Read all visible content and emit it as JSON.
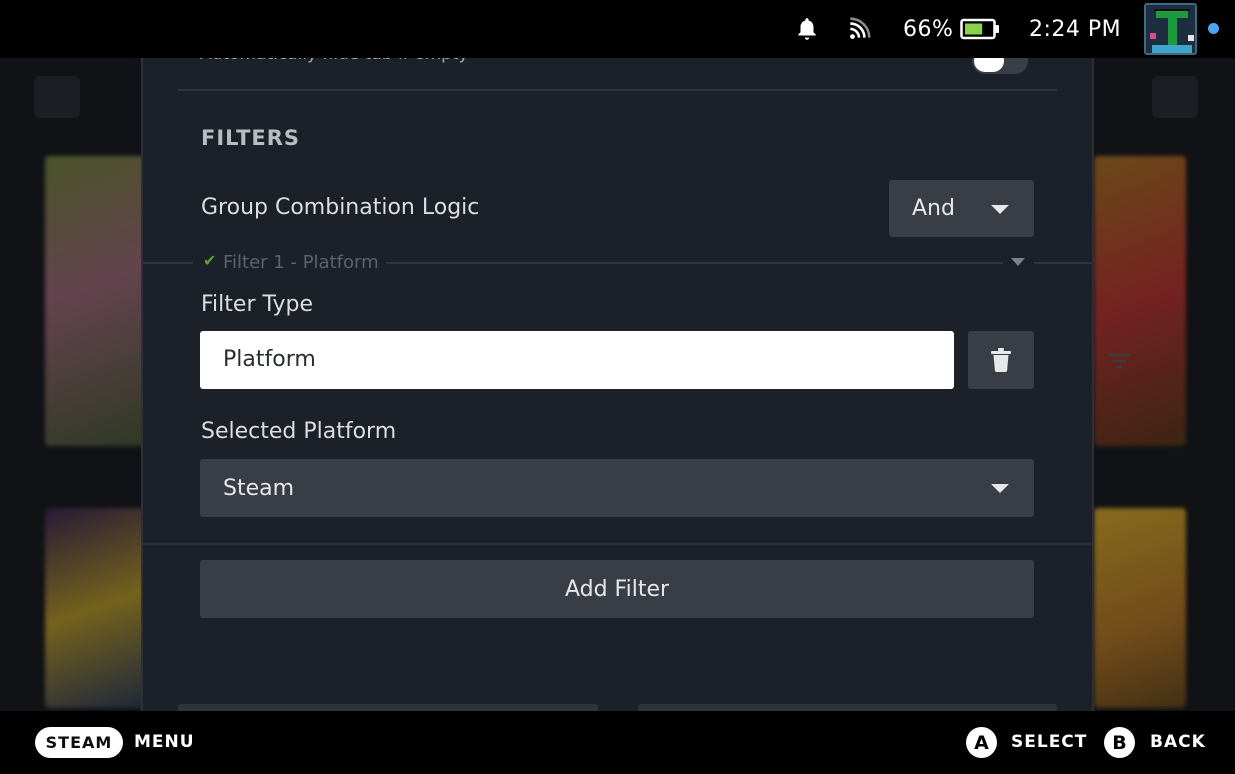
{
  "status_bar": {
    "battery_percent": "66%",
    "battery_level": 0.66,
    "time": "2:24 PM",
    "icons": [
      "bell-icon",
      "network-icon",
      "battery-icon"
    ]
  },
  "panel": {
    "hint_text": "Automatically hide tab if empty",
    "hide_toggle_on": false,
    "section_title": "FILTERS",
    "group_logic": {
      "label": "Group Combination Logic",
      "value": "And"
    },
    "filter": {
      "header": "Filter 1 - Platform",
      "type_label": "Filter Type",
      "type_value": "Platform",
      "selected_label": "Selected Platform",
      "selected_value": "Steam"
    },
    "add_filter_label": "Add Filter"
  },
  "footer": {
    "steam_label": "STEAM",
    "menu_label": "MENU",
    "a_glyph": "A",
    "select_label": "SELECT",
    "b_glyph": "B",
    "back_label": "BACK"
  },
  "colors": {
    "panel_bg": "#1b2029",
    "control_bg": "#393e46",
    "check_green": "#5ba32b",
    "online_blue": "#4fa3f7"
  }
}
